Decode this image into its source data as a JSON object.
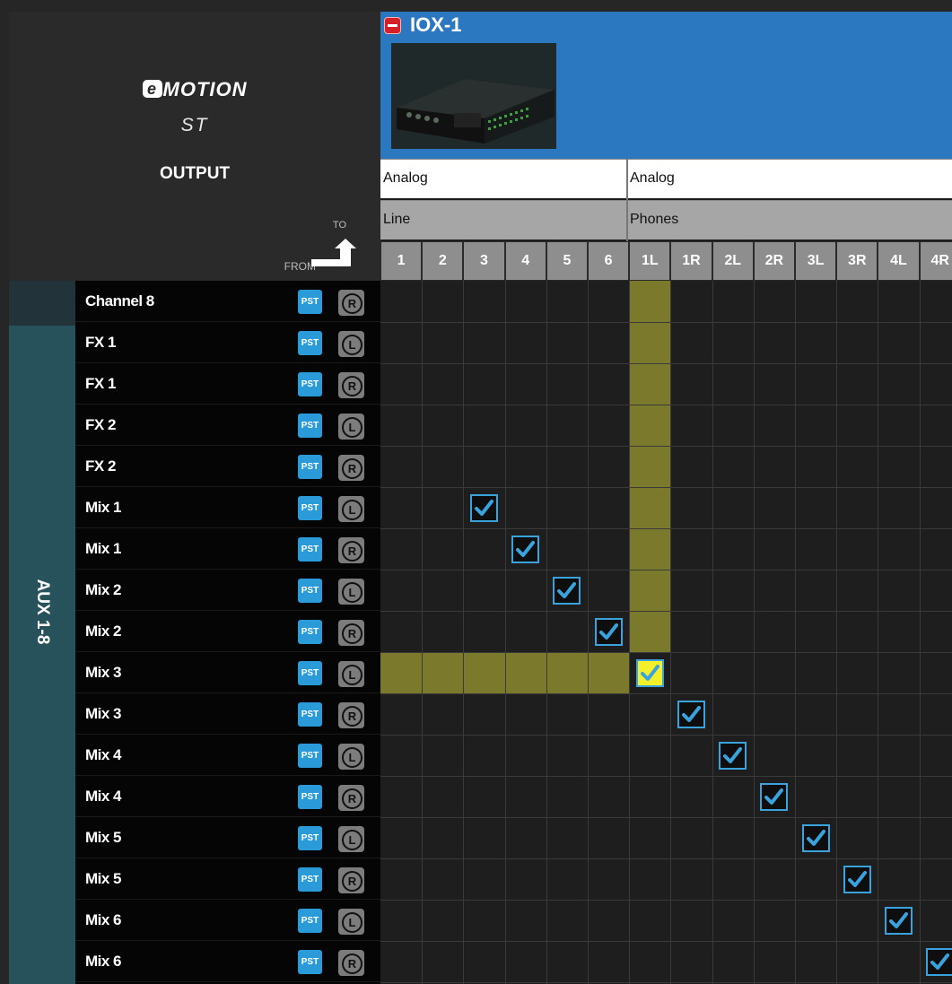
{
  "brand": {
    "logo_text": "MOTION",
    "logo_letter": "e",
    "line2": "ST",
    "section": "OUTPUT",
    "to_label": "TO",
    "from_label": "FROM"
  },
  "device": {
    "name": "IOX-1"
  },
  "groups": [
    {
      "type": "Analog",
      "sub": "Line"
    },
    {
      "type": "Analog",
      "sub": "Phones"
    }
  ],
  "columns": [
    "1",
    "2",
    "3",
    "4",
    "5",
    "6",
    "1L",
    "1R",
    "2L",
    "2R",
    "3L",
    "3R",
    "4L",
    "4R"
  ],
  "sidebar": {
    "group_label": "AUX 1-8",
    "pst_label": "PST"
  },
  "rows": [
    {
      "name": "Channel 8",
      "side": "R"
    },
    {
      "name": "FX 1",
      "side": "L"
    },
    {
      "name": "FX 1",
      "side": "R"
    },
    {
      "name": "FX 2",
      "side": "L"
    },
    {
      "name": "FX 2",
      "side": "R"
    },
    {
      "name": "Mix 1",
      "side": "L"
    },
    {
      "name": "Mix 1",
      "side": "R"
    },
    {
      "name": "Mix 2",
      "side": "L"
    },
    {
      "name": "Mix 2",
      "side": "R"
    },
    {
      "name": "Mix 3",
      "side": "L"
    },
    {
      "name": "Mix 3",
      "side": "R"
    },
    {
      "name": "Mix 4",
      "side": "L"
    },
    {
      "name": "Mix 4",
      "side": "R"
    },
    {
      "name": "Mix 5",
      "side": "L"
    },
    {
      "name": "Mix 5",
      "side": "R"
    },
    {
      "name": "Mix 6",
      "side": "L"
    },
    {
      "name": "Mix 6",
      "side": "R"
    }
  ],
  "routes": [
    {
      "row": 5,
      "col": 2
    },
    {
      "row": 6,
      "col": 3
    },
    {
      "row": 7,
      "col": 4
    },
    {
      "row": 8,
      "col": 5
    },
    {
      "row": 9,
      "col": 6,
      "selected": true
    },
    {
      "row": 10,
      "col": 7
    },
    {
      "row": 11,
      "col": 8
    },
    {
      "row": 12,
      "col": 9
    },
    {
      "row": 13,
      "col": 10
    },
    {
      "row": 14,
      "col": 11
    },
    {
      "row": 15,
      "col": 12
    },
    {
      "row": 16,
      "col": 13
    }
  ],
  "colors": {
    "accent": "#2b78c0",
    "highlight": "#7b7a2c",
    "selected": "#f3ef2a",
    "check": "#3aa3de"
  }
}
